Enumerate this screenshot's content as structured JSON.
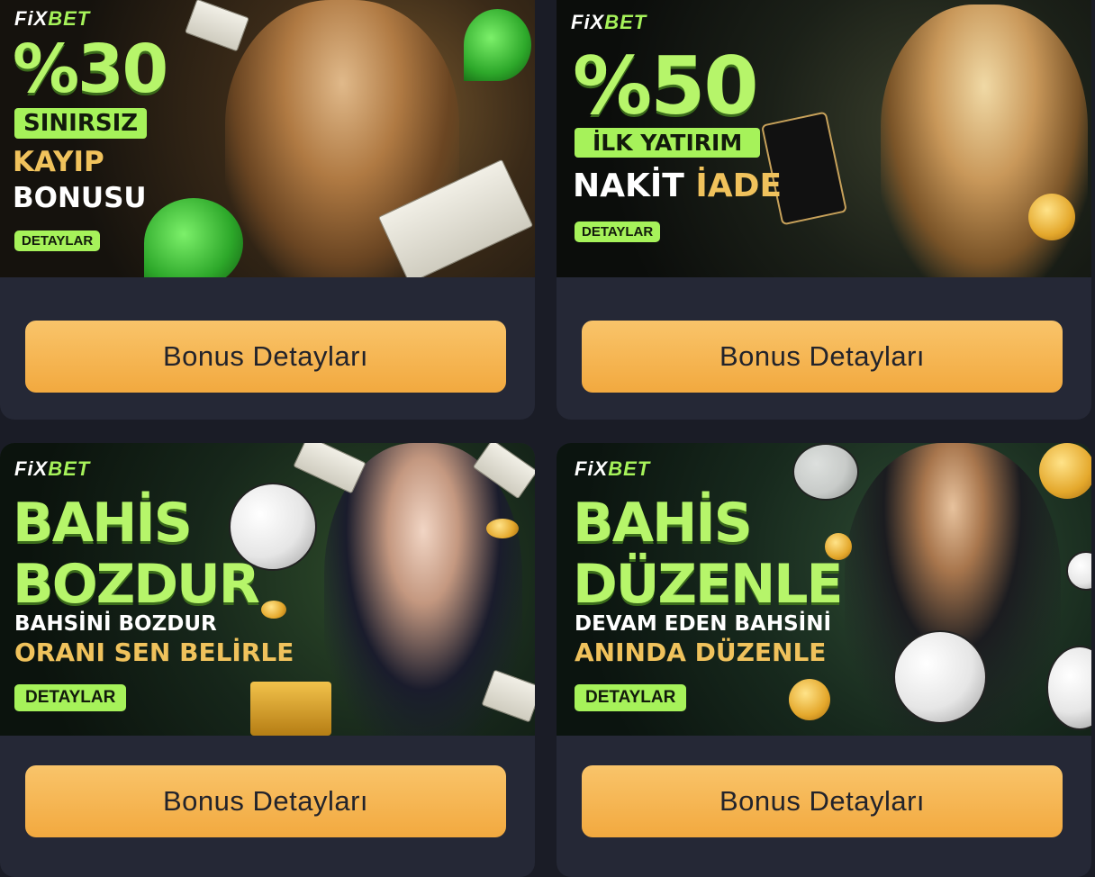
{
  "cards": [
    {
      "logo": {
        "prefix": "FiX",
        "suffix": "BET"
      },
      "headline": "%30",
      "pill": "SINIRSIZ",
      "line1": "KAYIP",
      "line2": "BONUSU",
      "details_label": "DETAYLAR",
      "button_label": "Bonus Detayları"
    },
    {
      "logo": {
        "prefix": "FiX",
        "suffix": "BET"
      },
      "headline": "%50",
      "pill": "İLK YATIRIM",
      "line1a": "NAKİT",
      "line1b": "İADE",
      "details_label": "DETAYLAR",
      "button_label": "Bonus Detayları"
    },
    {
      "logo": {
        "prefix": "FiX",
        "suffix": "BET"
      },
      "headline1": "BAHİS",
      "headline2": "BOZDUR",
      "line1": "BAHSİNİ BOZDUR",
      "line2": "ORANI SEN BELİRLE",
      "details_label": "DETAYLAR",
      "button_label": "Bonus Detayları"
    },
    {
      "logo": {
        "prefix": "FiX",
        "suffix": "BET"
      },
      "headline1": "BAHİS",
      "headline2": "DÜZENLE",
      "line1": "DEVAM EDEN BAHSİNİ",
      "line2": "ANINDA DÜZENLE",
      "details_label": "DETAYLAR",
      "button_label": "Bonus Detayları"
    }
  ],
  "colors": {
    "page_bg": "#1a1c26",
    "card_bg": "#252836",
    "button_bg": "#f5b24f",
    "accent_green": "#a6f25a",
    "gold_text": "#f0c25c"
  }
}
